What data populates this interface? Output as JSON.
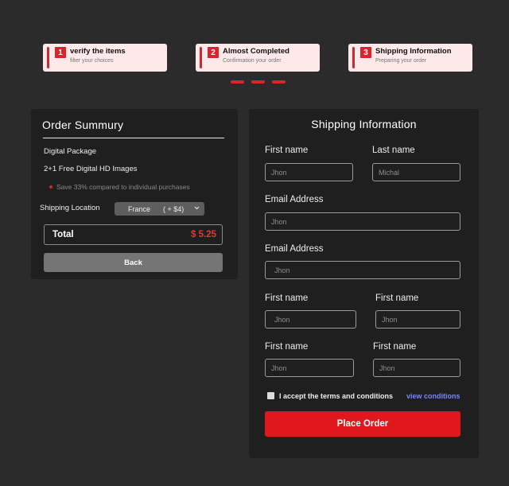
{
  "steps": [
    {
      "number": "1",
      "title": "verify the items",
      "subtitle": "filter your choices"
    },
    {
      "number": "2",
      "title": "Almost Completed",
      "subtitle": "Confirmation your order"
    },
    {
      "number": "3",
      "title": "Shipping Information",
      "subtitle": "Preparing your order"
    }
  ],
  "summary": {
    "title": "Order Summury",
    "item1": "Digital Package",
    "item2": "2+1 Free Digital HD Images",
    "savings_note": "Save 33% compared to individual purchases",
    "shipping_label": "Shipping Location",
    "shipping_country": "France",
    "shipping_price": "( + $4)",
    "total_label": "Total",
    "total_amount": "$ 5.25",
    "back_label": "Back"
  },
  "form": {
    "title": "Shipping Information",
    "row1": {
      "left_label": "First name",
      "left_placeholder": "Jhon",
      "right_label": "Last name",
      "right_placeholder": "Michal"
    },
    "email1": {
      "label": "Email Address",
      "placeholder": "Jhon"
    },
    "email2": {
      "label": "Email Address",
      "placeholder": "Jhon"
    },
    "row4": {
      "left_label": "First name",
      "left_placeholder": "Jhon",
      "right_label": "First name",
      "right_placeholder": "Jhon"
    },
    "row5": {
      "left_label": "First name",
      "left_placeholder": "Jhon",
      "right_label": "First name",
      "right_placeholder": "Jhon"
    },
    "terms_text": "I accept the terms and conditions",
    "view_conditions": "view conditions",
    "place_order": "Place Order"
  },
  "colors": {
    "accent": "#d8252b",
    "background": "#2b2b2b",
    "card": "#1f1f1f",
    "link": "#7a86f0",
    "total": "#e53935"
  }
}
